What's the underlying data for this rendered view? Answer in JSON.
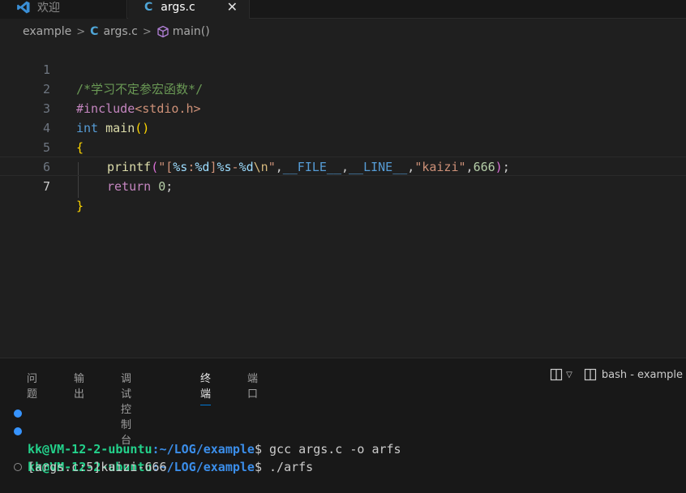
{
  "tabs": [
    {
      "label": "欢迎",
      "icon": "vscode-icon"
    },
    {
      "label": "args.c",
      "icon": "c-file-icon",
      "close": "✕"
    }
  ],
  "breadcrumb": {
    "folder": "example",
    "file_icon": "C",
    "file": "args.c",
    "symbol": "main()"
  },
  "editor": {
    "line_numbers": [
      "1",
      "2",
      "3",
      "4",
      "5",
      "6",
      "7"
    ],
    "lines": {
      "l1": {
        "comment": "/*学习不定参宏函数*/"
      },
      "l2": {
        "directive": "#include",
        "header": "<stdio.h>"
      },
      "l3": {
        "type": "int",
        "name": "main",
        "paren": "()"
      },
      "l4": {
        "brace": "{"
      },
      "l5": {
        "fn": "printf",
        "open": "(",
        "q1": "\"",
        "s1": "[",
        "f1": "%s",
        "s2": ":",
        "f2": "%d",
        "s3": "]",
        "f3": "%s",
        "s4": "-",
        "f4": "%d",
        "esc": "\\n",
        "q2": "\"",
        "c1": ",",
        "m1": "__FILE__",
        "c2": ",",
        "m2": "__LINE__",
        "c3": ",",
        "s5": "\"kaizi\"",
        "c4": ",",
        "n1": "666",
        "close": ")",
        "semi": ";"
      },
      "l6": {
        "kw": "return",
        "num": "0",
        "semi": ";"
      },
      "l7": {
        "brace": "}"
      }
    }
  },
  "panel": {
    "tabs": [
      "问题",
      "输出",
      "调试控制台",
      "终端",
      "端口"
    ],
    "active_tab": "终端",
    "terminal_name": "bash - example"
  },
  "terminal": {
    "user": "kk@VM-12-2-ubuntu",
    "path": ":~/LOG/example",
    "prompt_char": "$",
    "cmd1": " gcc args.c -o arfs",
    "cmd2": " ./arfs",
    "output": "[args.c:5]kaizi-666"
  },
  "colors": {
    "accent": "#0078d4",
    "prompt_user": "#23d18b",
    "prompt_path": "#3b8eea"
  }
}
